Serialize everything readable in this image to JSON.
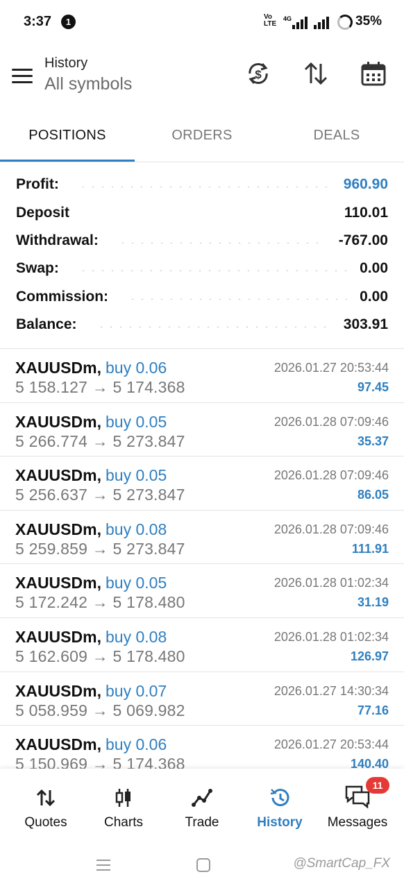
{
  "status_bar": {
    "time": "3:37",
    "notification_count": "1",
    "network": "4G",
    "battery": "35%"
  },
  "header": {
    "title": "History",
    "subtitle": "All symbols"
  },
  "tabs": [
    {
      "label": "POSITIONS",
      "active": true
    },
    {
      "label": "ORDERS",
      "active": false
    },
    {
      "label": "DEALS",
      "active": false
    }
  ],
  "summary": [
    {
      "label": "Profit:",
      "value": "960.90",
      "highlight": true
    },
    {
      "label": "Deposit",
      "value": "110.01",
      "highlight": false
    },
    {
      "label": "Withdrawal:",
      "value": "-767.00",
      "highlight": false
    },
    {
      "label": "Swap:",
      "value": "0.00",
      "highlight": false
    },
    {
      "label": "Commission:",
      "value": "0.00",
      "highlight": false
    },
    {
      "label": "Balance:",
      "value": "303.91",
      "highlight": false
    }
  ],
  "deals": [
    {
      "symbol": "XAUUSDm,",
      "side": "buy 0.06",
      "prices": "5 158.127 → 5 174.368",
      "time": "2026.01.27 20:53:44",
      "profit": "97.45"
    },
    {
      "symbol": "XAUUSDm,",
      "side": "buy 0.05",
      "prices": "5 266.774 → 5 273.847",
      "time": "2026.01.28 07:09:46",
      "profit": "35.37"
    },
    {
      "symbol": "XAUUSDm,",
      "side": "buy 0.05",
      "prices": "5 256.637 → 5 273.847",
      "time": "2026.01.28 07:09:46",
      "profit": "86.05"
    },
    {
      "symbol": "XAUUSDm,",
      "side": "buy 0.08",
      "prices": "5 259.859 → 5 273.847",
      "time": "2026.01.28 07:09:46",
      "profit": "111.91"
    },
    {
      "symbol": "XAUUSDm,",
      "side": "buy 0.05",
      "prices": "5 172.242 → 5 178.480",
      "time": "2026.01.28 01:02:34",
      "profit": "31.19"
    },
    {
      "symbol": "XAUUSDm,",
      "side": "buy 0.08",
      "prices": "5 162.609 → 5 178.480",
      "time": "2026.01.28 01:02:34",
      "profit": "126.97"
    },
    {
      "symbol": "XAUUSDm,",
      "side": "buy 0.07",
      "prices": "5 058.959 → 5 069.982",
      "time": "2026.01.27 14:30:34",
      "profit": "77.16"
    },
    {
      "symbol": "XAUUSDm,",
      "side": "buy 0.06",
      "prices": "5 150.969 → 5 174.368",
      "time": "2026.01.27 20:53:44",
      "profit": "140.40"
    }
  ],
  "bottom_nav": [
    {
      "label": "Quotes",
      "icon": "quotes-arrows-icon",
      "active": false
    },
    {
      "label": "Charts",
      "icon": "candlestick-icon",
      "active": false
    },
    {
      "label": "Trade",
      "icon": "trade-line-icon",
      "active": false
    },
    {
      "label": "History",
      "icon": "history-clock-icon",
      "active": true
    },
    {
      "label": "Messages",
      "icon": "chat-bubbles-icon",
      "active": false,
      "badge": "11"
    }
  ],
  "watermark": "@SmartCap_FX",
  "colors": {
    "accent": "#2f7fc0",
    "badge": "#e53935",
    "muted": "#777777"
  }
}
